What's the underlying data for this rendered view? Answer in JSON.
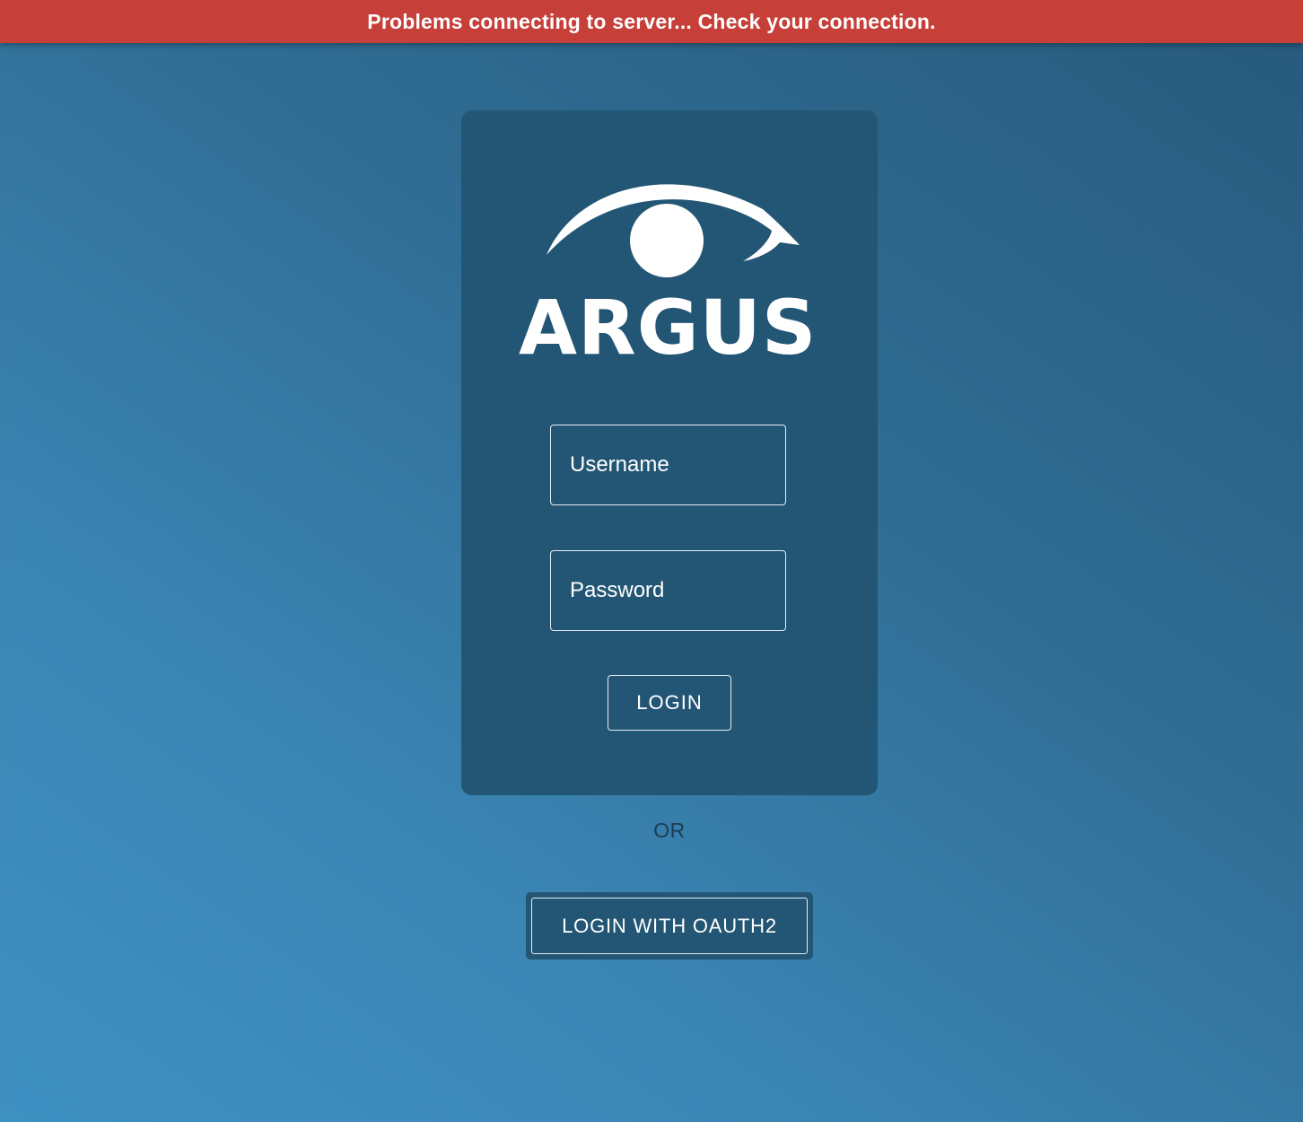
{
  "banner": {
    "message": "Problems connecting to server... Check your connection.",
    "color": "#c63f38"
  },
  "brand": {
    "logo_icon": "eye-icon",
    "name": "ARGUS"
  },
  "form": {
    "username_placeholder": "Username",
    "password_placeholder": "Password",
    "login_label": "LOGIN"
  },
  "alternative": {
    "separator": "OR",
    "oauth_label": "LOGIN WITH OAUTH2"
  },
  "colors": {
    "card": "#235674",
    "background_light": "#3f91c3",
    "background_dark": "#275a7c"
  }
}
